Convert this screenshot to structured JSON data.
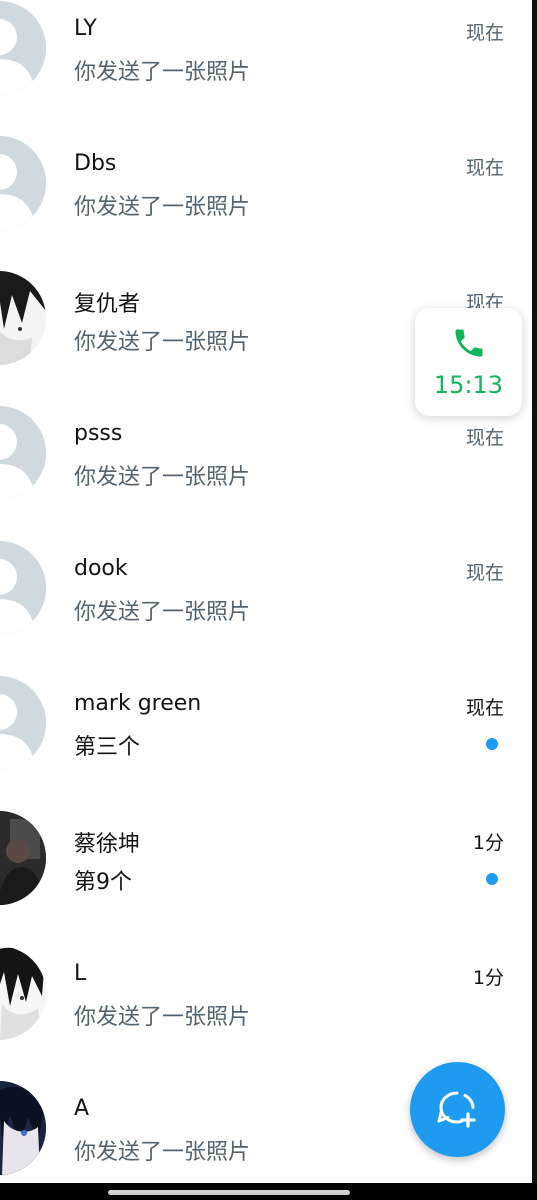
{
  "conversations": [
    {
      "name": "LY",
      "preview": "你发送了一张照片",
      "time": "现在",
      "unread": false,
      "avatar": "default-avatar"
    },
    {
      "name": "Dbs",
      "preview": "你发送了一张照片",
      "time": "现在",
      "unread": false,
      "avatar": "default-avatar"
    },
    {
      "name": "复仇者",
      "preview": "你发送了一张照片",
      "time": "现在",
      "unread": false,
      "avatar": "anime-avatar"
    },
    {
      "name": "psss",
      "preview": "你发送了一张照片",
      "time": "现在",
      "unread": false,
      "avatar": "default-avatar"
    },
    {
      "name": "dook",
      "preview": "你发送了一张照片",
      "time": "现在",
      "unread": false,
      "avatar": "default-avatar"
    },
    {
      "name": "mark green",
      "preview": "第三个",
      "time": "现在",
      "unread": true,
      "avatar": "default-avatar"
    },
    {
      "name": "蔡徐坤",
      "preview": "第9个",
      "time": "1分",
      "unread": true,
      "avatar": "photo-avatar"
    },
    {
      "name": "L",
      "preview": "你发送了一张照片",
      "time": "1分",
      "unread": false,
      "avatar": "anime-avatar"
    },
    {
      "name": "A",
      "preview": "你发送了一张照片",
      "time": "",
      "unread": false,
      "avatar": "anime-avatar"
    }
  ],
  "call_widget": {
    "time": "15:13",
    "icon": "phone-icon",
    "color": "#12b55a"
  },
  "fab": {
    "icon": "new-message-icon",
    "color": "#1d9bf0"
  },
  "colors": {
    "accent": "#1d9bf0",
    "secondary_text": "#536471",
    "primary_text": "#0f1419"
  }
}
